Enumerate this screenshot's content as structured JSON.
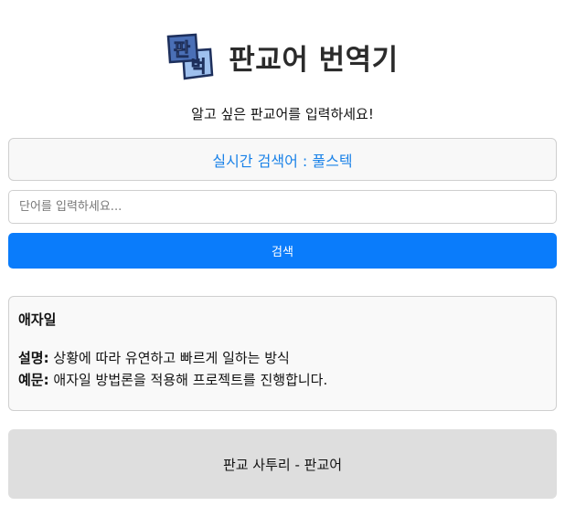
{
  "header": {
    "title": "판교어 번역기",
    "logo_icon": "pangyo-logo-icon",
    "logo_text_top": "판",
    "logo_text_bottom": "벅",
    "logo_color": "#4a6fb6"
  },
  "subtitle": "알고 싶은 판교어를 입력하세요!",
  "realtime": {
    "text": "실시간 검색어 : 풀스텍",
    "color": "#1a82e8"
  },
  "search": {
    "placeholder": "단어를 입력하세요...",
    "value": "",
    "button_label": "검색",
    "button_color": "#0a7cfb"
  },
  "result": {
    "word": "애자일",
    "description_label": "설명:",
    "description": "상황에 따라 유연하고 빠르게 일하는 방식",
    "example_label": "예문:",
    "example": "애자일 방법론을 적용해 프로젝트를 진행합니다."
  },
  "footer": {
    "text": "판교 사투리 - 판교어"
  }
}
